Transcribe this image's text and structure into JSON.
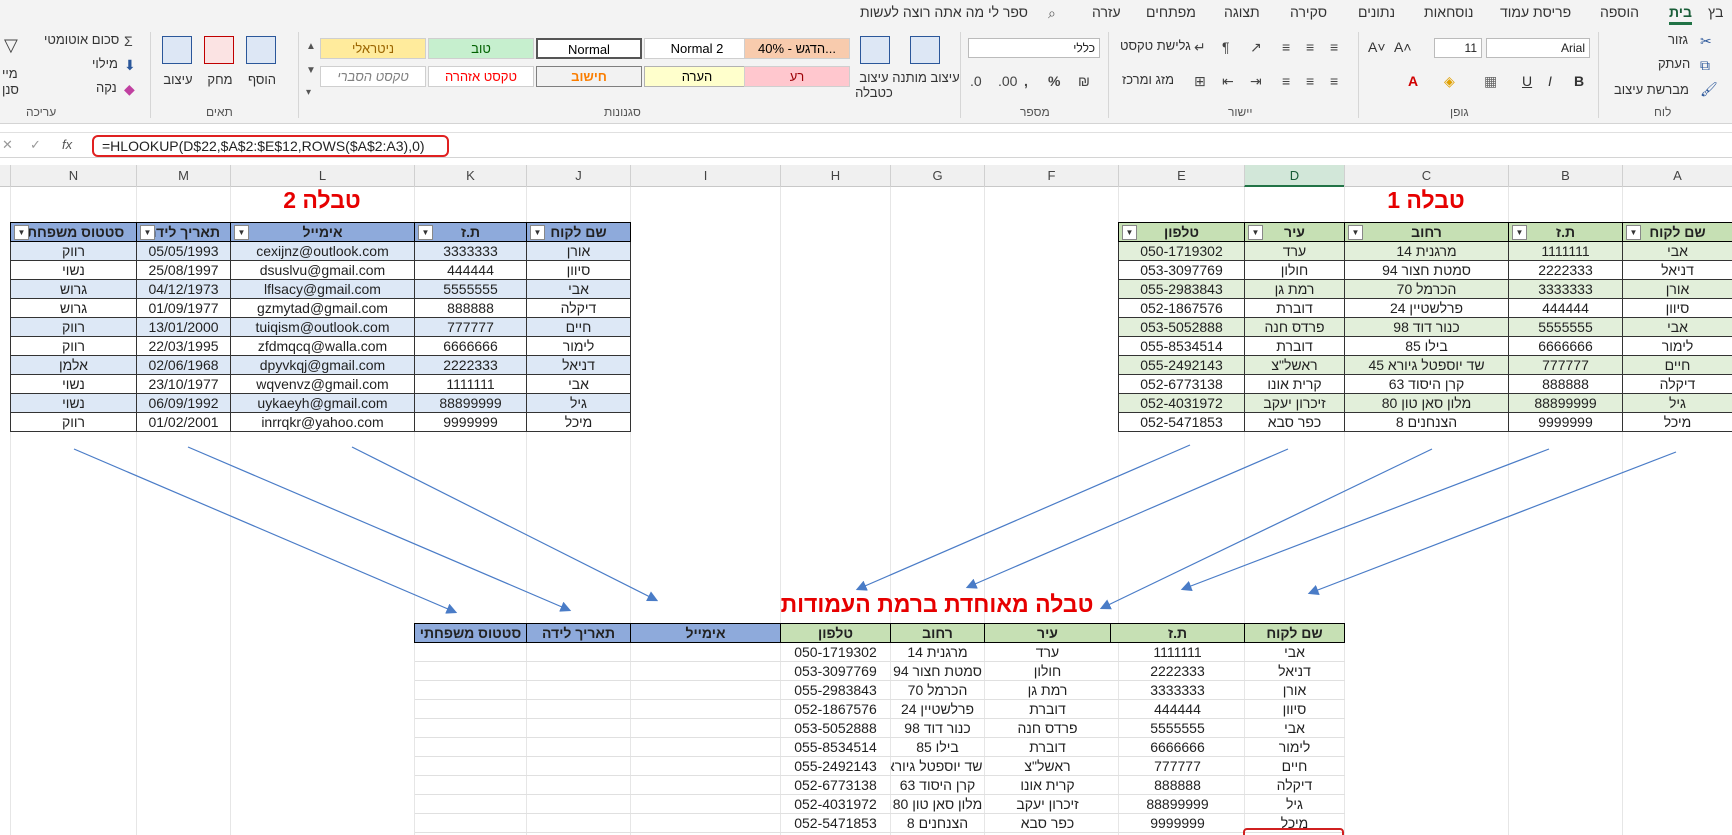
{
  "tabs": [
    "בית",
    "הוספה",
    "פריסת עמוד",
    "נוסחאות",
    "נתונים",
    "סקירה",
    "תצוגה",
    "מפתחים",
    "עזרה",
    "ספר לי מה אתה רוצה לעשות",
    "בץ"
  ],
  "ribbon": {
    "clipboard": {
      "label": "לוח",
      "cut": "גזור",
      "copy": "העתק",
      "painter": "מברשת עיצוב"
    },
    "font": {
      "label": "גופן",
      "name": "Arial",
      "size": "11"
    },
    "align": {
      "label": "יישור",
      "wrap": "גלישת טקסט",
      "merge": "מזג ומרכז"
    },
    "number": {
      "label": "מספר",
      "format": "כללי"
    },
    "styles": {
      "label": "סגנונות",
      "conditional": "עיצוב מותנה",
      "astable": "עיצוב כטבלה",
      "items": [
        "ניטראלי",
        "טוב",
        "Normal",
        "Normal 2",
        "40% - הדגש...",
        "טקסט הסברי",
        "טקסט אזהרה",
        "חישוב",
        "הערה",
        "רע"
      ]
    },
    "cells": {
      "label": "תאים",
      "format": "עיצוב",
      "delete": "מחק",
      "insert": "הוסף"
    },
    "editing": {
      "label": "עריכה",
      "autosum": "סכום אוטומטי",
      "fill": "מילוי",
      "clear": "נקה",
      "sort": "מיי",
      "find": "סנן"
    }
  },
  "formula_bar": {
    "fx": "fx",
    "text": "=HLOOKUP(D$22,$A$2:$E$12,ROWS($A$2:A3),0)"
  },
  "columns": [
    "A",
    "B",
    "C",
    "D",
    "E",
    "F",
    "G",
    "H",
    "I",
    "J",
    "K",
    "L",
    "M",
    "N"
  ],
  "titles": {
    "t1": "טבלה 1",
    "t2": "טבלה 2",
    "t3": "טבלה מאוחדת ברמת העמודות"
  },
  "table1": {
    "headers": [
      "שם לקוח",
      "ת.ז",
      "רחוב",
      "עיר",
      "טלפון"
    ],
    "rows": [
      [
        "אבי",
        "1111111",
        "מרגנית 14",
        "ערד",
        "050-1719302"
      ],
      [
        "דניאל",
        "2222333",
        "סמטת חצור 94",
        "חולון",
        "053-3097769"
      ],
      [
        "אורן",
        "3333333",
        "הכרמל 70",
        "רמת גן",
        "055-2983843"
      ],
      [
        "סיוון",
        "444444",
        "פרלשטיין 24",
        "דוברת",
        "052-1867576"
      ],
      [
        "אבי",
        "5555555",
        "כנור דוד 98",
        "פרדס חנה",
        "053-5052888"
      ],
      [
        "לימור",
        "6666666",
        "בילו 85",
        "דוברת",
        "055-8534514"
      ],
      [
        "חיים",
        "777777",
        "שד יוספטל גיורא 45",
        "ראשל\"צ",
        "055-2492143"
      ],
      [
        "דיקלה",
        "888888",
        "קרן היסוד 63",
        "קרית אונו",
        "052-6773138"
      ],
      [
        "גיל",
        "88899999",
        "מלון סאן טון 80",
        "זיכרון יעקב",
        "052-4031972"
      ],
      [
        "מיכל",
        "9999999",
        "הצנחנים 8",
        "כפר סבא",
        "052-5471853"
      ]
    ]
  },
  "table2": {
    "headers": [
      "שם לקוח",
      "ת.ז",
      "אימייל",
      "תאריך לידה",
      "סטטוס משפחתי"
    ],
    "rows": [
      [
        "אורן",
        "3333333",
        "cexijnz@outlook.com",
        "05/05/1993",
        "רווק"
      ],
      [
        "סיוון",
        "444444",
        "dsuslvu@gmail.com",
        "25/08/1997",
        "נשוי"
      ],
      [
        "אבי",
        "5555555",
        "lflsacy@gmail.com",
        "04/12/1973",
        "גרוש"
      ],
      [
        "דיקלה",
        "888888",
        "gzmytad@gmail.com",
        "01/09/1977",
        "גרוש"
      ],
      [
        "חיים",
        "777777",
        "tuiqism@outlook.com",
        "13/01/2000",
        "רווק"
      ],
      [
        "לימור",
        "6666666",
        "zfdmqcq@walla.com",
        "22/03/1995",
        "רווק"
      ],
      [
        "דניאל",
        "2222333",
        "dpyvkqj@gmail.com",
        "02/06/1968",
        "אלמן"
      ],
      [
        "אבי",
        "1111111",
        "wqvenvz@gmail.com",
        "23/10/1977",
        "נשוי"
      ],
      [
        "גיל",
        "88899999",
        "uykaeyh@gmail.com",
        "06/09/1992",
        "נשוי"
      ],
      [
        "מיכל",
        "9999999",
        "inrrqkr@yahoo.com",
        "01/02/2001",
        "רווק"
      ]
    ]
  },
  "table3": {
    "headers": [
      "שם לקוח",
      "ת.ז",
      "עיר",
      "רחוב",
      "טלפון",
      "אימייל",
      "תאריך לידה",
      "סטטוס משפחתי"
    ],
    "rows": [
      [
        "אבי",
        "1111111",
        "ערד",
        "מרגנית 14",
        "050-1719302",
        "",
        "",
        ""
      ],
      [
        "דניאל",
        "2222333",
        "חולון",
        "סמטת חצור 94",
        "053-3097769",
        "",
        "",
        ""
      ],
      [
        "אורן",
        "3333333",
        "רמת גן",
        "הכרמל 70",
        "055-2983843",
        "",
        "",
        ""
      ],
      [
        "סיוון",
        "444444",
        "דוברת",
        "פרלשטיין 24",
        "052-1867576",
        "",
        "",
        ""
      ],
      [
        "אבי",
        "5555555",
        "פרדס חנה",
        "כנור דוד 98",
        "053-5052888",
        "",
        "",
        ""
      ],
      [
        "לימור",
        "6666666",
        "דוברת",
        "בילו 85",
        "055-8534514",
        "",
        "",
        ""
      ],
      [
        "חיים",
        "777777",
        "ראשל\"צ",
        "שד יוספטל גיורא 45",
        "055-2492143",
        "",
        "",
        ""
      ],
      [
        "דיקלה",
        "888888",
        "קרית אונו",
        "קרן היסוד 63",
        "052-6773138",
        "",
        "",
        ""
      ],
      [
        "גיל",
        "88899999",
        "זיכרון יעקב",
        "מלון סאן טון 80",
        "052-4031972",
        "",
        "",
        ""
      ],
      [
        "מיכל",
        "9999999",
        "כפר סבא",
        "הצנחנים 8",
        "052-5471853",
        "",
        "",
        ""
      ]
    ]
  }
}
